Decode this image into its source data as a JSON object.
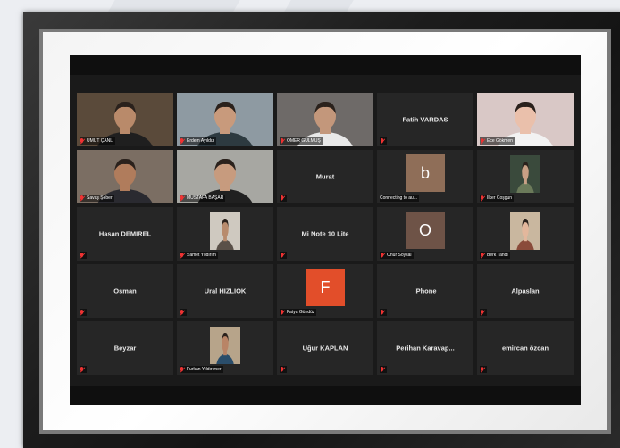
{
  "participants": [
    {
      "name": "UMUT ÇANLI",
      "type": "video",
      "bg": "#5a4a3a",
      "skin": "#b98a6a",
      "shirt": "#1f1f1f",
      "muted": true
    },
    {
      "name": "Erdem Ayıldız",
      "type": "video",
      "bg": "#8e9aa2",
      "skin": "#c89a7c",
      "shirt": "#2d3a40",
      "muted": true
    },
    {
      "name": "ÖMER GÜLMÜŞ",
      "type": "video",
      "bg": "#6e6a68",
      "skin": "#c3977b",
      "shirt": "#e8e8e8",
      "muted": true
    },
    {
      "name": "Fatih VARDAS",
      "type": "name",
      "muted": true
    },
    {
      "name": "Ece Gökmen",
      "type": "video",
      "bg": "#d9c8c6",
      "skin": "#eac0ab",
      "shirt": "#f2f2f2",
      "muted": true
    },
    {
      "name": "Savaş Şeber",
      "type": "video",
      "bg": "#7b6e63",
      "skin": "#b07c5c",
      "shirt": "#2a2a30",
      "muted": true,
      "speaking": true
    },
    {
      "name": "MUSTAFA BAŞAR",
      "type": "video",
      "bg": "#a7a7a2",
      "skin": "#c79b7e",
      "shirt": "#202020",
      "muted": true
    },
    {
      "name": "Murat",
      "type": "name",
      "muted": true
    },
    {
      "name": "Connecting to au...",
      "type": "avatar",
      "letter": "b",
      "avatar_color": "#8f6e58",
      "muted": false
    },
    {
      "name": "İlker Coşgun",
      "type": "photo",
      "bg": "#3a4a3c",
      "skin": "#c8a085",
      "shirt": "#6b7a5a",
      "muted": true
    },
    {
      "name": "Hasan DEMIREL",
      "type": "name",
      "muted": true
    },
    {
      "name": "Samet Yıldırım",
      "type": "photo",
      "bg": "#cfc9c0",
      "skin": "#b88b6d",
      "shirt": "#5a5048",
      "muted": true
    },
    {
      "name": "Mi Note 10 Lite",
      "type": "name",
      "muted": true
    },
    {
      "name": "Onur Soysal",
      "type": "avatar",
      "letter": "O",
      "avatar_color": "#6e5347",
      "muted": true
    },
    {
      "name": "Berk Tandı",
      "type": "photo",
      "bg": "#c9b79f",
      "skin": "#e3b79c",
      "shirt": "#8a4b3a",
      "muted": true
    },
    {
      "name": "Osman",
      "type": "name",
      "muted": true
    },
    {
      "name": "Ural HIZLIOK",
      "type": "name",
      "muted": true
    },
    {
      "name": "Fatya Gündüz",
      "type": "avatar",
      "letter": "F",
      "avatar_color": "#e24e2a",
      "muted": true
    },
    {
      "name": "iPhone",
      "type": "name",
      "muted": true
    },
    {
      "name": "Alpaslan",
      "type": "name",
      "muted": true
    },
    {
      "name": "Beyzar",
      "type": "name",
      "muted": true
    },
    {
      "name": "Furkan Yıldırımer",
      "type": "photo",
      "bg": "#b7a48a",
      "skin": "#b98466",
      "shirt": "#2a4d6a",
      "muted": true
    },
    {
      "name": "Uğur KAPLAN",
      "type": "name",
      "muted": true
    },
    {
      "name": "Perihan Karavap...",
      "type": "name",
      "muted": true
    },
    {
      "name": "emircan özcan",
      "type": "name",
      "muted": true
    }
  ]
}
